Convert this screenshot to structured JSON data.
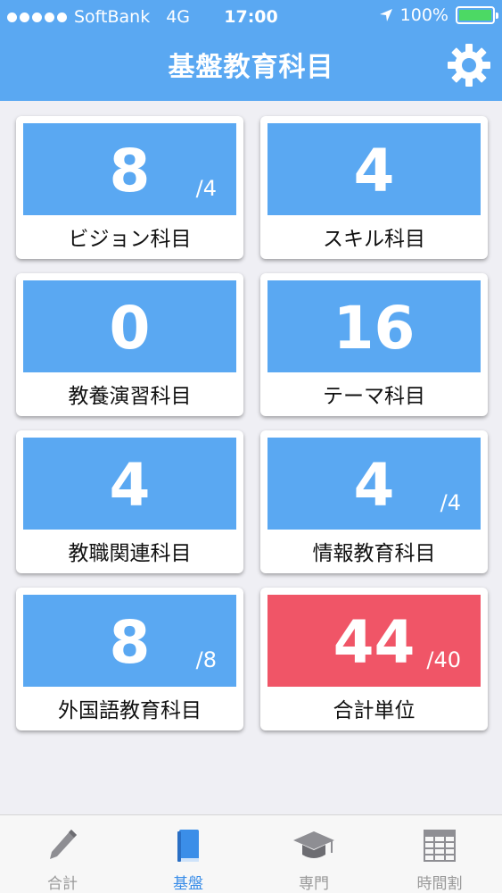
{
  "status": {
    "carrier": "SoftBank",
    "network": "4G",
    "time": "17:00",
    "battery": "100%"
  },
  "header": {
    "title": "基盤教育科目",
    "settings_icon": "gear-icon"
  },
  "cards": [
    {
      "value": "8",
      "sub": "/4",
      "label": "ビジョン科目"
    },
    {
      "value": "4",
      "sub": "",
      "label": "スキル科目"
    },
    {
      "value": "0",
      "sub": "",
      "label": "教養演習科目"
    },
    {
      "value": "16",
      "sub": "",
      "label": "テーマ科目"
    },
    {
      "value": "4",
      "sub": "",
      "label": "教職関連科目"
    },
    {
      "value": "4",
      "sub": "/4",
      "label": "情報教育科目"
    },
    {
      "value": "8",
      "sub": "/8",
      "label": "外国語教育科目"
    },
    {
      "value": "44",
      "sub": "/40",
      "label": "合計単位"
    }
  ],
  "colors": {
    "accent": "#5aa8f2",
    "alert": "#f05567",
    "active_tab": "#3b8ee8"
  },
  "tabs": [
    {
      "label": "合計",
      "icon": "pencil-icon"
    },
    {
      "label": "基盤",
      "icon": "book-icon"
    },
    {
      "label": "専門",
      "icon": "graduation-cap-icon"
    },
    {
      "label": "時間割",
      "icon": "timetable-icon"
    }
  ]
}
